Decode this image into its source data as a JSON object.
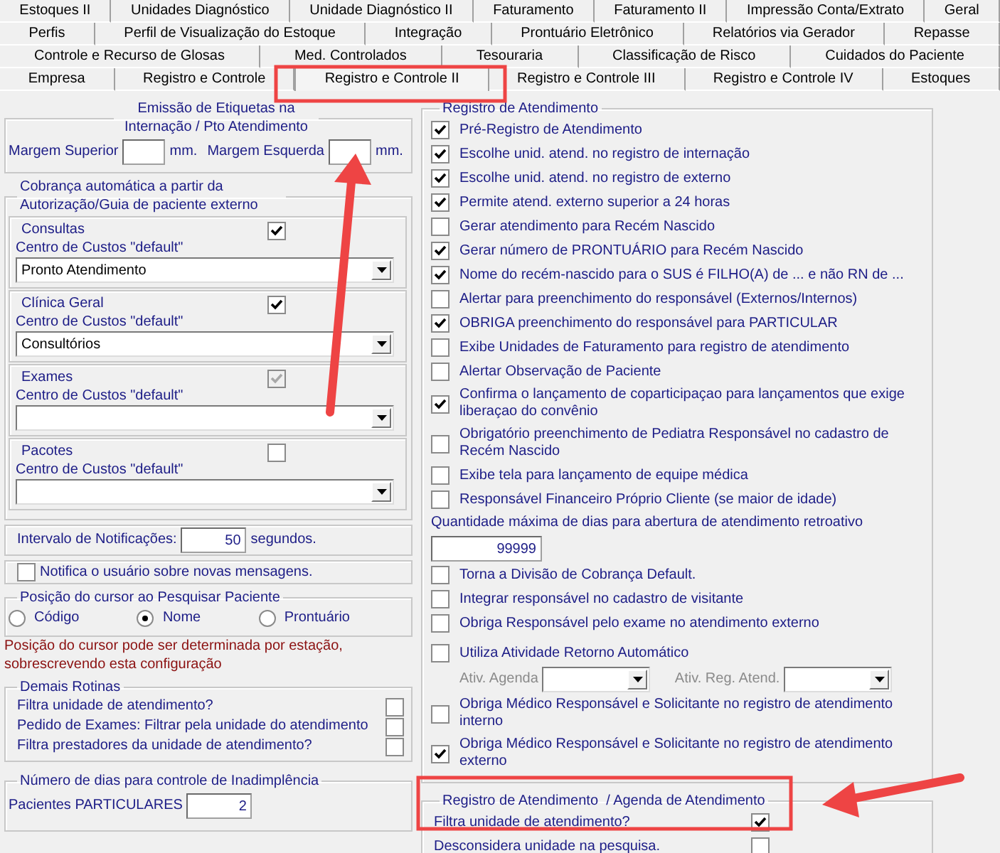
{
  "tab_rows": [
    {
      "tabs": [
        {
          "label": "Estoques II",
          "selected": false
        },
        {
          "label": "Unidades Diagnóstico",
          "selected": false
        },
        {
          "label": "Unidade Diagnóstico II",
          "selected": false
        },
        {
          "label": "Faturamento",
          "selected": false
        },
        {
          "label": "Faturamento II",
          "selected": false
        },
        {
          "label": "Impressão Conta/Extrato",
          "selected": false
        },
        {
          "label": "Geral",
          "selected": false
        }
      ]
    },
    {
      "tabs": [
        {
          "label": "Perfis",
          "selected": false
        },
        {
          "label": "Perfil de Visualização do Estoque",
          "selected": false
        },
        {
          "label": "Integração",
          "selected": false
        },
        {
          "label": "Prontuário Eletrônico",
          "selected": false
        },
        {
          "label": "Relatórios via Gerador",
          "selected": false
        },
        {
          "label": "Repasse",
          "selected": false
        }
      ]
    },
    {
      "tabs": [
        {
          "label": "Controle e Recurso de Glosas",
          "selected": false
        },
        {
          "label": "Med. Controlados",
          "selected": false
        },
        {
          "label": "Tesouraria",
          "selected": false
        },
        {
          "label": "Classificação de Risco",
          "selected": false
        },
        {
          "label": "Cuidados do Paciente",
          "selected": false
        }
      ]
    },
    {
      "tabs": [
        {
          "label": "Empresa",
          "selected": false
        },
        {
          "label": "Registro e Controle",
          "selected": false
        },
        {
          "label": "Registro e Controle II",
          "selected": true
        },
        {
          "label": "Registro e Controle III",
          "selected": false
        },
        {
          "label": "Registro e Controle IV",
          "selected": false
        },
        {
          "label": "Estoques",
          "selected": false
        }
      ]
    }
  ],
  "label_printing": {
    "title": "Emissão de Etiquetas na Internação / Pto Atendimento",
    "top_margin_label": "Margem Superior",
    "top_margin_unit": "mm.",
    "left_margin_label": "Margem Esquerda",
    "left_margin_unit": "mm."
  },
  "auto_billing": {
    "title": "Cobrança automática a partir da Autorização/Guia de paciente externo",
    "groups": [
      {
        "name": "Consultas",
        "checked": true,
        "disabled": false,
        "cost_center_label": "Centro de Custos \"default\"",
        "value": "Pronto Atendimento"
      },
      {
        "name": "Clínica Geral",
        "checked": true,
        "disabled": false,
        "cost_center_label": "Centro de Custos \"default\"",
        "value": "Consultórios"
      },
      {
        "name": "Exames",
        "checked": true,
        "disabled": true,
        "cost_center_label": "Centro de Custos \"default\""
      },
      {
        "name": "Pacotes",
        "checked": false,
        "disabled": false,
        "cost_center_label": "Centro de Custos \"default\""
      }
    ]
  },
  "notification_interval": {
    "label": "Intervalo de Notificações:",
    "value": "50",
    "unit": "segundos."
  },
  "notify_messages": {
    "label": "Notifica o usuário sobre novas mensagens.",
    "checked": false
  },
  "cursor_position": {
    "title": "Posição do cursor ao Pesquisar Paciente",
    "options": [
      {
        "label": "Código",
        "selected": false
      },
      {
        "label": "Nome",
        "selected": true
      },
      {
        "label": "Prontuário",
        "selected": false
      }
    ]
  },
  "cursor_note": "Posição do cursor pode ser determinada por estação, sobrescrevendo esta configuração",
  "other_routines": {
    "title": "Demais Rotinas",
    "items": [
      {
        "label": "Filtra unidade de atendimento?",
        "checked": false
      },
      {
        "label": "Pedido de Exames: Filtrar pela unidade do atendimento",
        "checked": false
      },
      {
        "label": "Filtra prestadores da unidade de atendimento?",
        "checked": false
      }
    ]
  },
  "overdue_days": {
    "title": "Número de dias para controle de Inadimplência",
    "label": "Pacientes PARTICULARES",
    "value": "2"
  },
  "attendance_registration": {
    "title": "Registro de Atendimento",
    "items": [
      {
        "kind": "checkbox",
        "label": "Pré-Registro de Atendimento",
        "checked": true
      },
      {
        "kind": "checkbox",
        "label": "Escolhe unid. atend. no registro de internação",
        "checked": true
      },
      {
        "kind": "checkbox",
        "label": "Escolhe unid. atend. no registro de externo",
        "checked": true
      },
      {
        "kind": "checkbox",
        "label": "Permite atend. externo superior a 24 horas",
        "checked": true
      },
      {
        "kind": "checkbox",
        "label": "Gerar atendimento para Recém Nascido",
        "checked": false
      },
      {
        "kind": "checkbox",
        "label": "Gerar número de PRONTUÁRIO para Recém Nascido",
        "checked": true
      },
      {
        "kind": "checkbox",
        "label": "Nome do recém-nascido para o SUS é FILHO(A) de ... e não RN de ...",
        "checked": true
      },
      {
        "kind": "checkbox",
        "label": "Alertar para preenchimento do responsável (Externos/Internos)",
        "checked": false
      },
      {
        "kind": "checkbox",
        "label": "OBRIGA preenchimento do responsável para PARTICULAR",
        "checked": true
      },
      {
        "kind": "checkbox",
        "label": "Exibe Unidades de Faturamento para registro de atendimento",
        "checked": false
      },
      {
        "kind": "checkbox",
        "label": "Alertar Observação de Paciente",
        "checked": false
      },
      {
        "kind": "checkbox",
        "label": "Confirma o lançamento de coparticipaçao para lançamentos que exige liberaçao do convênio",
        "checked": true
      },
      {
        "kind": "checkbox",
        "label": "Obrigatório preenchimento de Pediatra Responsável no cadastro de Recém Nascido",
        "checked": false
      },
      {
        "kind": "checkbox",
        "label": "Exibe tela para lançamento de equipe médica",
        "checked": false
      },
      {
        "kind": "checkbox",
        "label": "Responsável Financeiro Próprio Cliente (se maior de idade)",
        "checked": false
      },
      {
        "kind": "number",
        "label": "Quantidade máxima de dias para abertura de atendimento retroativo",
        "value": "99999"
      },
      {
        "kind": "checkbox",
        "label": "Torna a Divisão de Cobrança Default.",
        "checked": false
      },
      {
        "kind": "checkbox",
        "label": "Integrar responsável no cadastro de visitante",
        "checked": false
      },
      {
        "kind": "checkbox",
        "label": "Obriga Responsável pelo exame no atendimento externo",
        "checked": false
      },
      {
        "kind": "spacer"
      },
      {
        "kind": "checkbox",
        "label": "Utiliza Atividade Retorno Automático",
        "checked": false
      },
      {
        "kind": "dropdowns",
        "first_label": "Ativ. Agenda",
        "second_label": "Ativ. Reg. Atend."
      },
      {
        "kind": "checkbox",
        "label": "Obriga Médico Responsável e Solicitante no registro de atendimento interno",
        "checked": false
      },
      {
        "kind": "checkbox",
        "label": "Obriga Médico Responsável e Solicitante no registro de atendimento externo",
        "checked": true
      }
    ]
  },
  "schedule": {
    "title": "Registro de Atendimento  / Agenda de Atendimento",
    "items": [
      {
        "label": "Filtra unidade de atendimento?",
        "checked": true
      },
      {
        "label": "Desconsidera unidade na pesquisa.",
        "checked": false
      }
    ]
  }
}
